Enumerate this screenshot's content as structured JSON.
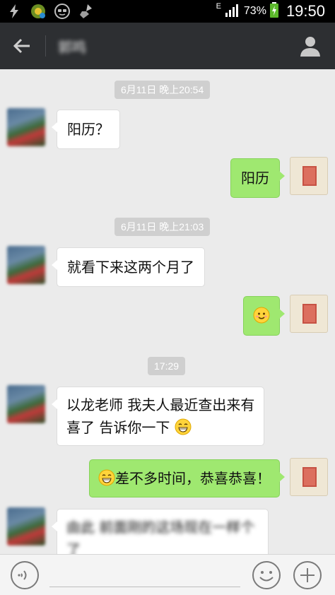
{
  "status_bar": {
    "network": "E",
    "battery_percent": "73%",
    "time": "19:50"
  },
  "header": {
    "title": "郭鸣"
  },
  "messages": [
    {
      "type": "time",
      "text": "6月11日 晚上20:54"
    },
    {
      "type": "left",
      "text": "阳历？"
    },
    {
      "type": "right",
      "text": "阳历"
    },
    {
      "type": "time",
      "text": "6月11日 晚上21:03"
    },
    {
      "type": "left",
      "text": "就看下来这两个月了"
    },
    {
      "type": "right",
      "emoji": "smile-emoji"
    },
    {
      "type": "time",
      "text": "17:29"
    },
    {
      "type": "left",
      "line1": "以龙老师 我夫人最近查出来有",
      "line2": "喜了 告诉你一下",
      "emoji": "grin-emoji"
    },
    {
      "type": "right",
      "text": "差不多时间，恭喜恭喜！",
      "emoji": "grin-emoji"
    },
    {
      "type": "left",
      "text": "由此 前面刚的这场现在一样个 了"
    }
  ],
  "colors": {
    "header_bg": "#2d2f32",
    "chat_bg": "#ebebeb",
    "sent_bubble": "#9fe870",
    "received_bubble": "#ffffff"
  }
}
